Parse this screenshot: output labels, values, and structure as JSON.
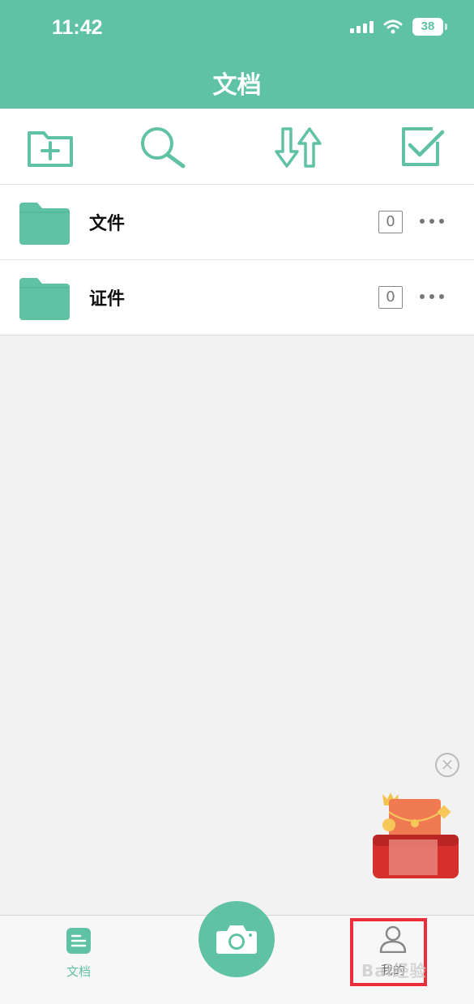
{
  "status_bar": {
    "time": "11:42",
    "battery": "38"
  },
  "header": {
    "title": "文档"
  },
  "toolbar": {
    "items": [
      {
        "icon": "new-folder-icon"
      },
      {
        "icon": "search-icon"
      },
      {
        "icon": "sort-icon"
      },
      {
        "icon": "select-icon"
      }
    ]
  },
  "folders": [
    {
      "name": "文件",
      "count": "0"
    },
    {
      "name": "证件",
      "count": "0"
    }
  ],
  "tabbar": {
    "docs_label": "文档",
    "mine_label": "我的"
  },
  "watermark": "Bai经验",
  "colors": {
    "accent": "#5fc2a4",
    "highlight": "#ee2d3a",
    "promo": "#e8473a"
  }
}
